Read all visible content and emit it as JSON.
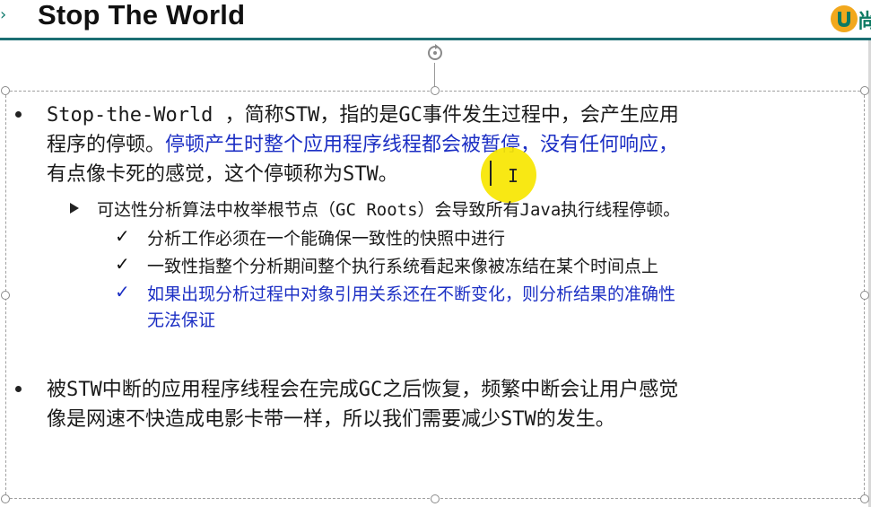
{
  "slide": {
    "title": "Stop The World",
    "logo_text": "尚"
  },
  "bullets": [
    {
      "lines": [
        [
          {
            "text": "Stop-the-World ，简称STW，指的是GC事件发生过程中，会产生应用",
            "blue": false
          }
        ],
        [
          {
            "text": "程序的停顿。",
            "blue": false
          },
          {
            "text": "停顿产生时整个应用程序线程都会被暂停，没有任何响应，",
            "blue": true
          }
        ],
        [
          {
            "text": "有点像卡死的感觉，这个停顿称为STW。",
            "blue": false
          }
        ]
      ]
    },
    {
      "lines": [
        [
          {
            "text": "被STW中断的应用程序线程会在完成GC之后恢复，频繁中断会让用户感觉",
            "blue": false
          }
        ],
        [
          {
            "text": "像是网速不快造成电影卡带一样，所以我们需要减少STW的发生。",
            "blue": false
          }
        ]
      ]
    }
  ],
  "sub_bullet": {
    "text": "可达性分析算法中枚举根节点（GC Roots）会导致所有Java执行线程停顿。",
    "checks": [
      {
        "lines": [
          "分析工作必须在一个能确保一致性的快照中进行"
        ],
        "blue": false
      },
      {
        "lines": [
          "一致性指整个分析期间整个执行系统看起来像被冻结在某个时间点上"
        ],
        "blue": false
      },
      {
        "lines": [
          "如果出现分析过程中对象引用关系还在不断变化，则分析结果的准确性",
          "无法保证"
        ],
        "blue": true
      }
    ]
  },
  "colors": {
    "accent_rule": "#1b6e73",
    "emphasis_text": "#1c2fc4",
    "cursor_highlight": "#f7e600"
  },
  "icons": [
    "rotate-handle-icon",
    "logo-icon",
    "text-cursor-icon",
    "triangle-bullet-icon",
    "check-icon"
  ]
}
